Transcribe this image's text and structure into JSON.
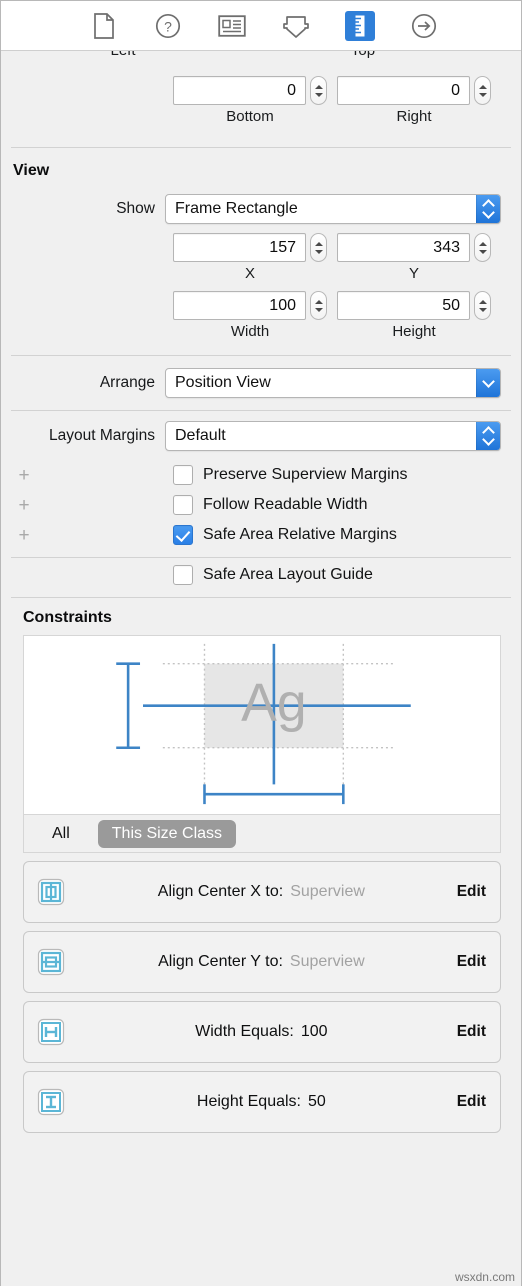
{
  "toolbar": {
    "items": [
      {
        "name": "file-icon",
        "selected": false
      },
      {
        "name": "help-icon",
        "selected": false
      },
      {
        "name": "identity-card-icon",
        "selected": false
      },
      {
        "name": "attributes-icon",
        "selected": false
      },
      {
        "name": "ruler-icon",
        "selected": true
      },
      {
        "name": "connections-arrow-icon",
        "selected": false
      }
    ],
    "selected_color": "#2f7fd8"
  },
  "margins": {
    "top_clipped_labels": {
      "left": "Left",
      "top": "Top"
    },
    "bottom_field": {
      "value": "0",
      "label": "Bottom"
    },
    "right_field": {
      "value": "0",
      "label": "Right"
    }
  },
  "view": {
    "title": "View",
    "show_label": "Show",
    "show_value": "Frame Rectangle",
    "x": {
      "value": "157",
      "label": "X"
    },
    "y": {
      "value": "343",
      "label": "Y"
    },
    "width": {
      "value": "100",
      "label": "Width"
    },
    "height": {
      "value": "50",
      "label": "Height"
    },
    "arrange_label": "Arrange",
    "arrange_value": "Position View",
    "layout_margins_label": "Layout Margins",
    "layout_margins_value": "Default",
    "checkboxes": [
      {
        "label": "Preserve Superview Margins",
        "checked": false,
        "has_plus": true
      },
      {
        "label": "Follow Readable Width",
        "checked": false,
        "has_plus": true
      },
      {
        "label": "Safe Area Relative Margins",
        "checked": true,
        "has_plus": true
      },
      {
        "label": "Safe Area Layout Guide",
        "checked": false,
        "has_plus": false
      }
    ],
    "checked_color": "#2a7fe6"
  },
  "constraints": {
    "title": "Constraints",
    "diagram_placeholder": "Ag",
    "diagram_line_color": "#3d84c6",
    "scope": {
      "all": "All",
      "this_size_class": "This Size Class",
      "selected": "This Size Class"
    },
    "rows": [
      {
        "icon": "align-center-x-icon",
        "label": "Align Center X to:",
        "value": "Superview",
        "value_muted": true,
        "edit": "Edit"
      },
      {
        "icon": "align-center-y-icon",
        "label": "Align Center Y to:",
        "value": "Superview",
        "value_muted": true,
        "edit": "Edit"
      },
      {
        "icon": "width-equals-icon",
        "label": "Width Equals:",
        "value": "100",
        "value_muted": false,
        "edit": "Edit"
      },
      {
        "icon": "height-equals-icon",
        "label": "Height Equals:",
        "value": "50",
        "value_muted": false,
        "edit": "Edit"
      }
    ]
  },
  "watermark": "wsxdn.com"
}
